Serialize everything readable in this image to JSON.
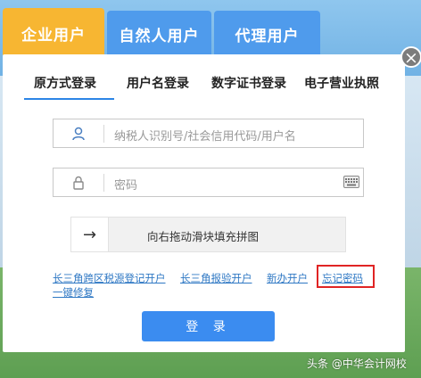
{
  "tabs": {
    "enterprise": "企业用户",
    "individual": "自然人用户",
    "agent": "代理用户"
  },
  "close_symbol": "×",
  "login_methods": [
    "原方式登录",
    "用户名登录",
    "数字证书登录",
    "电子营业执照"
  ],
  "taxpayer_field": {
    "placeholder": "纳税人识别号/社会信用代码/用户名",
    "icon": "user-icon"
  },
  "password_field": {
    "placeholder": "密码",
    "icon": "lock-icon",
    "keyboard_icon": "keyboard-icon"
  },
  "slider": {
    "label": "向右拖动滑块填充拼图",
    "handle_symbol": "→"
  },
  "links": {
    "yangtze_cross_region": "长三角跨区税源登记开户",
    "yangtze_check": "长三角报验开户",
    "new_account": "新办开户",
    "forgot_password": "忘记密码",
    "one_click_repair": "一键修复"
  },
  "login_button": "登 录",
  "watermark": "头条 @中华会计网校",
  "colors": {
    "active_tab": "#f7b632",
    "inactive_tab": "#4f9bec",
    "accent": "#2c85e6",
    "login_button": "#3b8cf0",
    "highlight_box": "#e02424"
  }
}
